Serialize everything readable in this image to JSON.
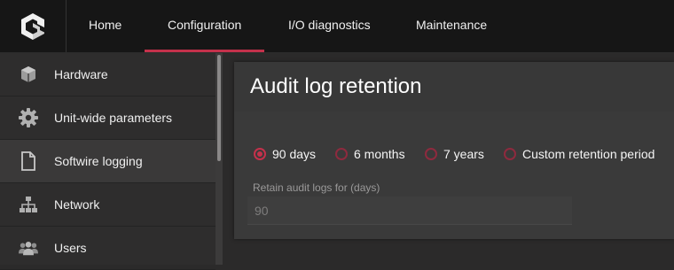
{
  "nav": {
    "tabs": [
      {
        "label": "Home"
      },
      {
        "label": "Configuration",
        "active": true
      },
      {
        "label": "I/O diagnostics"
      },
      {
        "label": "Maintenance"
      }
    ]
  },
  "sidebar": {
    "items": [
      {
        "label": "Hardware",
        "icon": "cube-icon"
      },
      {
        "label": "Unit-wide parameters",
        "icon": "gear-icon"
      },
      {
        "label": "Softwire logging",
        "icon": "document-icon",
        "active": true
      },
      {
        "label": "Network",
        "icon": "network-icon"
      },
      {
        "label": "Users",
        "icon": "users-icon"
      }
    ]
  },
  "main": {
    "title": "Audit log retention",
    "options": [
      {
        "label": "90 days",
        "checked": true
      },
      {
        "label": "6 months"
      },
      {
        "label": "7 years"
      },
      {
        "label": "Custom retention period"
      }
    ],
    "field": {
      "label": "Retain audit logs for (days)",
      "placeholder": "90"
    }
  },
  "colors": {
    "accent": "#c4314b",
    "topbar": "#161616",
    "sidebar": "#2e2d2d",
    "panel": "#3a3a3a"
  }
}
